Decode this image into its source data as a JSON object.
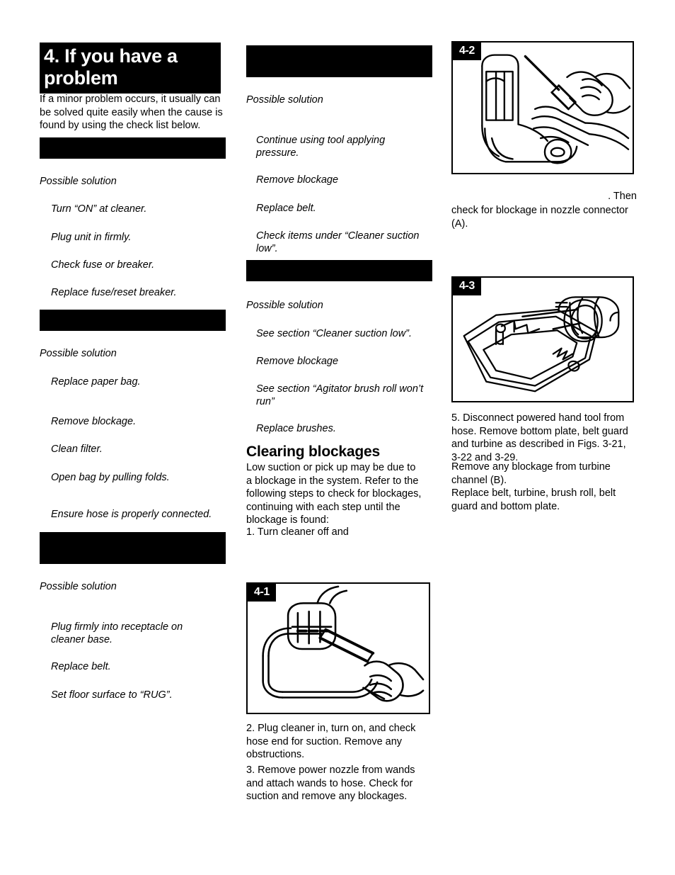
{
  "document": {
    "title": "4. If you have a problem",
    "intro": "If a minor problem occurs, it usually can be solved quite easily when the cause is found by using the check list below.",
    "possible_solution_label": "Possible solution"
  },
  "column1": {
    "section1": {
      "header_redacted": "",
      "solutions": [
        "Turn “ON” at cleaner.",
        "Plug unit in firmly.",
        "Check fuse or breaker.",
        "Replace fuse/reset breaker."
      ]
    },
    "section2": {
      "header_redacted": "",
      "solutions": [
        "Replace paper bag.",
        "Remove blockage.",
        "Clean filter.",
        "Open bag by pulling folds.",
        "Ensure hose is properly connected."
      ]
    },
    "section3": {
      "header_redacted": "",
      "solutions": [
        "Plug firmly into receptacle on cleaner base.",
        "Replace belt.",
        "Set floor surface to “RUG”."
      ]
    }
  },
  "column2": {
    "section1": {
      "header_redacted": "",
      "solutions": [
        "Continue using tool applying pressure.",
        "Remove blockage",
        "Replace belt.",
        "Check items under “Cleaner suction low”."
      ]
    },
    "section2": {
      "header_redacted": "",
      "solutions": [
        "See section “Cleaner suction low”.",
        "Remove blockage",
        "See section “Agitator brush roll  won’t run”",
        "Replace brushes."
      ]
    },
    "clearing_blockages": {
      "heading": "Clearing blockages",
      "body": "Low suction or pick up may be due to a blockage in the system.  Refer to the following steps to check for blockages, continuing with each step until the blockage is found:",
      "step1": "1. Turn cleaner off and"
    },
    "figure_4_1": {
      "label": "4-1",
      "caption_step2": "2. Plug cleaner in, turn on, and check hose end for suction.  Remove any obstructions.",
      "caption_step3": "3. Remove power nozzle from wands and attach wands to hose.  Check for suction and remove any blockages."
    }
  },
  "column3": {
    "figure_4_2": {
      "label": "4-2",
      "caption_line1": ".  Then",
      "caption_line2": "check for blockage in nozzle connector (A)."
    },
    "figure_4_3": {
      "label": "4-3",
      "caption_step5": "5. Disconnect powered hand tool from hose. Remove bottom plate, belt guard and turbine as described in Figs. 3-21, 3-22 and 3-29.",
      "caption_step5b": "Remove any blockage from turbine channel (B).",
      "caption_step5c": "Replace belt, turbine, brush roll, belt guard and bottom plate."
    }
  },
  "colors": {
    "ink": "#000000",
    "paper": "#ffffff"
  }
}
